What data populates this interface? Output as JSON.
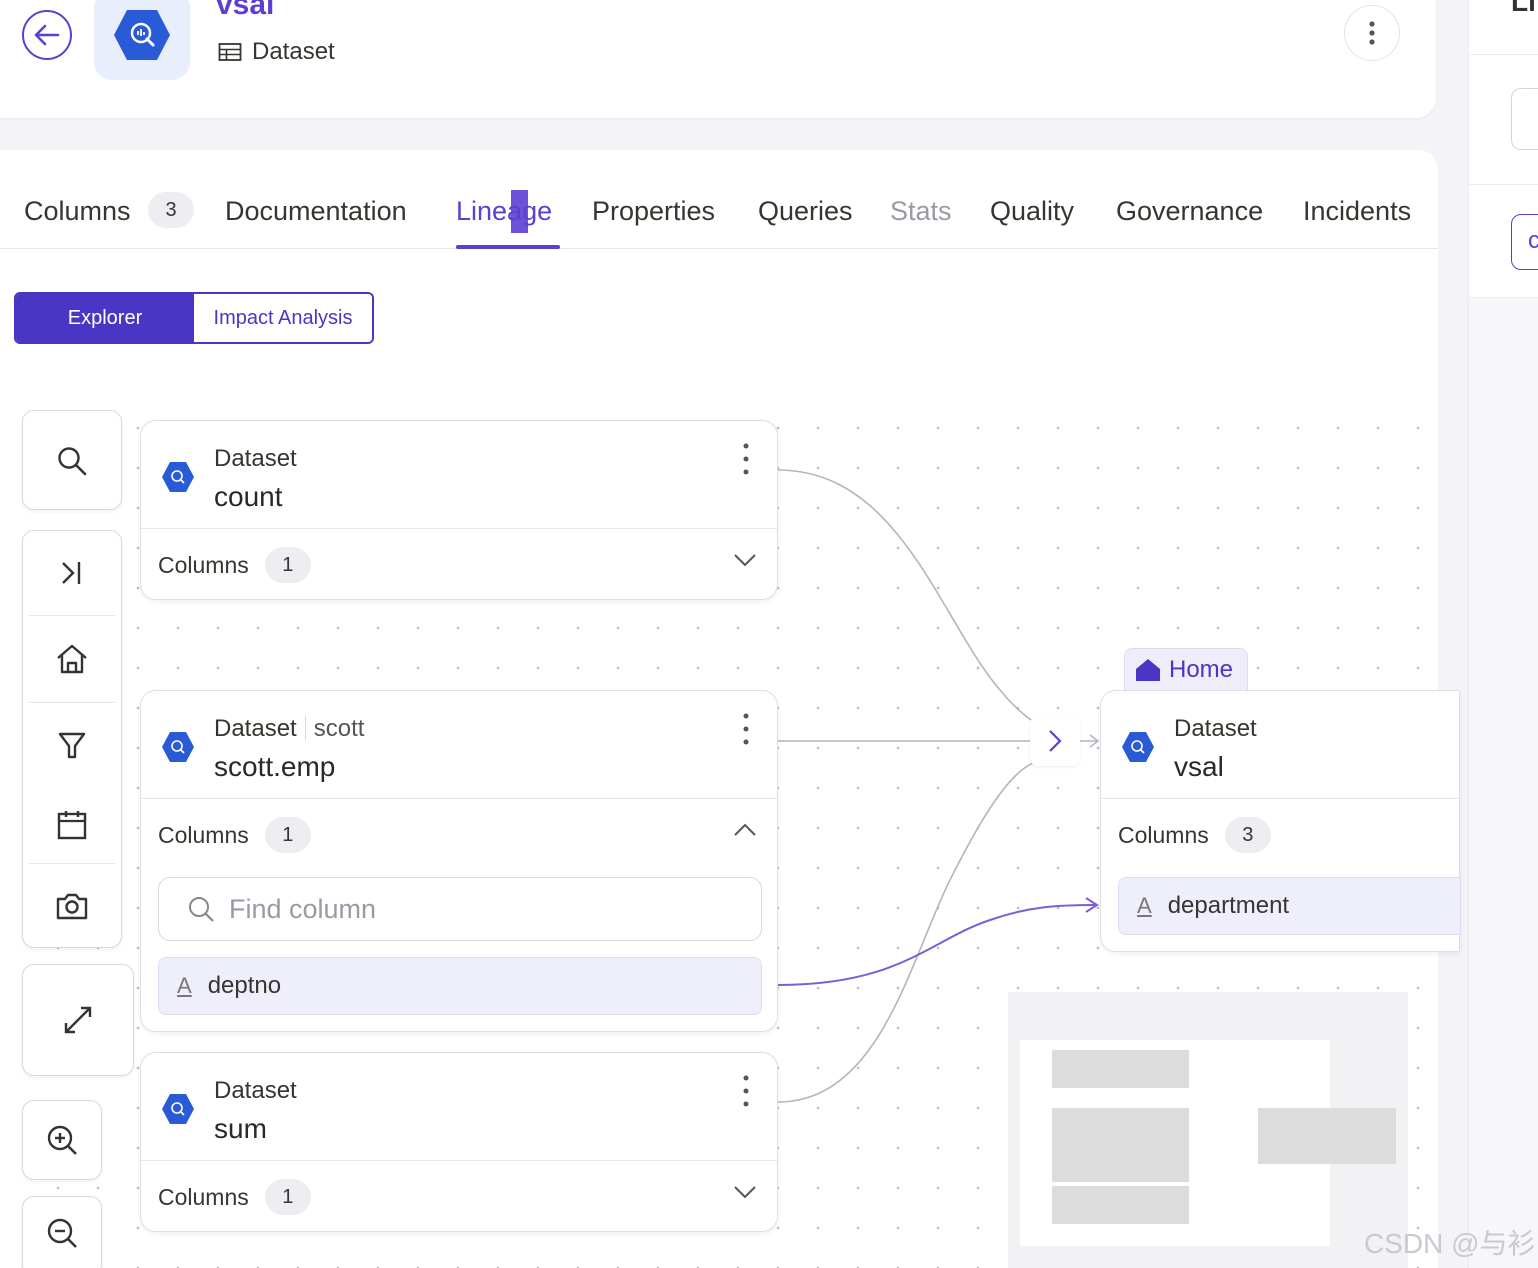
{
  "header": {
    "entity_name": "vsal",
    "entity_type": "Dataset"
  },
  "right_panel": {
    "title_fragment": "Li",
    "box_fragment": "c"
  },
  "tabs": [
    {
      "label": "Columns",
      "badge": "3"
    },
    {
      "label": "Documentation"
    },
    {
      "label": "Lineage",
      "active": true
    },
    {
      "label": "Properties"
    },
    {
      "label": "Queries"
    },
    {
      "label": "Stats",
      "disabled": true
    },
    {
      "label": "Quality"
    },
    {
      "label": "Governance"
    },
    {
      "label": "Incidents"
    }
  ],
  "view_toggle": {
    "explorer": "Explorer",
    "impact": "Impact Analysis",
    "selected": "Explorer"
  },
  "controls": {
    "search": "search-icon",
    "collapse": "collapse-icon",
    "home": "home-icon",
    "filter": "filter-icon",
    "calendar": "calendar-icon",
    "screenshot": "camera-icon",
    "fit": "fit-icon",
    "zoom_in": "zoom-in-icon",
    "zoom_out": "zoom-out-icon"
  },
  "nodes": {
    "count": {
      "type": "Dataset",
      "name": "count",
      "columns_label": "Columns",
      "columns_count": "1",
      "expanded": false
    },
    "scott": {
      "type": "Dataset",
      "service": "scott",
      "name": "scott.emp",
      "columns_label": "Columns",
      "columns_count": "1",
      "expanded": true,
      "find_placeholder": "Find column",
      "column": "deptno"
    },
    "sum": {
      "type": "Dataset",
      "name": "sum",
      "columns_label": "Columns",
      "columns_count": "1",
      "expanded": false
    },
    "vsal": {
      "home_tag": "Home",
      "type": "Dataset",
      "name": "vsal",
      "columns_label": "Columns",
      "columns_count": "3",
      "column": "department"
    }
  },
  "colors": {
    "accent": "#5b3fd1",
    "toggle": "#4a36c4",
    "bigquery_blue": "#2a5bd7",
    "column_edge": "#7c5fd6"
  },
  "watermark": "CSDN @与衫"
}
